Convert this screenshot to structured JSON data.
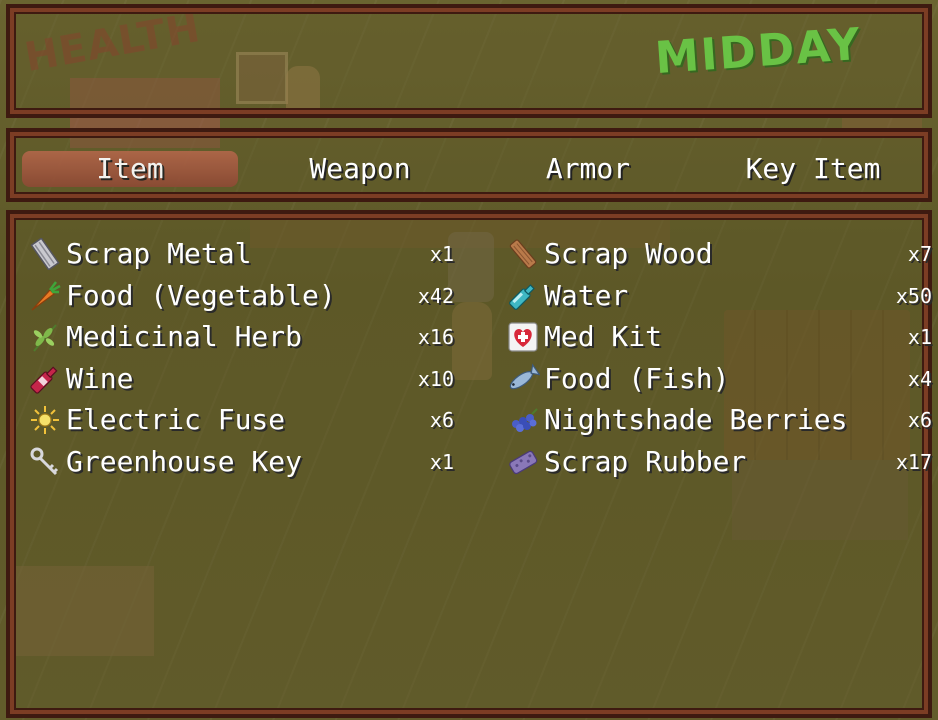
{
  "status": {
    "health_label": "HEALTH",
    "time_of_day": "MIDDAY"
  },
  "tabs": [
    {
      "label": "Item",
      "selected": true
    },
    {
      "label": "Weapon",
      "selected": false
    },
    {
      "label": "Armor",
      "selected": false
    },
    {
      "label": "Key Item",
      "selected": false
    }
  ],
  "items_left": [
    {
      "name": "Scrap Metal",
      "qty": "x1",
      "icon": "scrap-metal-icon"
    },
    {
      "name": "Food (Vegetable)",
      "qty": "x42",
      "icon": "carrot-icon"
    },
    {
      "name": "Medicinal Herb",
      "qty": "x16",
      "icon": "herb-icon"
    },
    {
      "name": "Wine",
      "qty": "x10",
      "icon": "wine-bottle-icon"
    },
    {
      "name": "Electric Fuse",
      "qty": "x6",
      "icon": "electric-fuse-icon"
    },
    {
      "name": "Greenhouse Key",
      "qty": "x1",
      "icon": "key-icon"
    }
  ],
  "items_right": [
    {
      "name": "Scrap Wood",
      "qty": "x7",
      "icon": "wood-plank-icon"
    },
    {
      "name": "Water",
      "qty": "x50",
      "icon": "water-bottle-icon"
    },
    {
      "name": "Med Kit",
      "qty": "x1",
      "icon": "med-kit-icon"
    },
    {
      "name": "Food (Fish)",
      "qty": "x4",
      "icon": "fish-icon"
    },
    {
      "name": "Nightshade Berries",
      "qty": "x6",
      "icon": "berries-icon"
    },
    {
      "name": "Scrap Rubber",
      "qty": "x17",
      "icon": "scrap-rubber-icon"
    }
  ],
  "colors": {
    "window_border": "#3e1a10",
    "window_frame": "#7c3d24",
    "selected_tab": "#a65c42",
    "midday_text": "#6bd44a",
    "health_text": "#9a3a2f",
    "text": "#ffffff"
  }
}
